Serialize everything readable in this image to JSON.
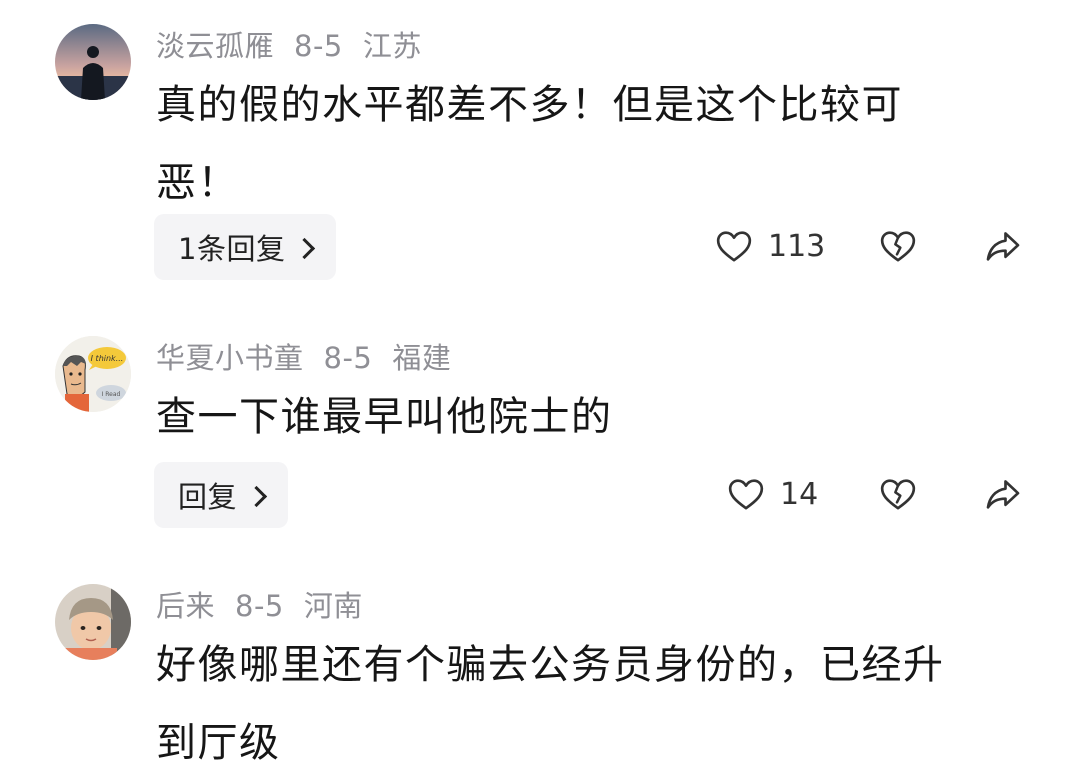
{
  "comments": [
    {
      "username": "淡云孤雁",
      "date": "8-5",
      "location": "江苏",
      "text_line1": "真的假的水平都差不多！但是这个比较可",
      "text_line2": "恶！",
      "reply_label": "1条回复",
      "like_count": "113",
      "avatar_icon": "silhouette-sunset-avatar",
      "accent_color": "#8f8f95"
    },
    {
      "username": "华夏小书童",
      "date": "8-5",
      "location": "福建",
      "text_line1": "查一下谁最早叫他院士的",
      "reply_label": "回复",
      "like_count": "14",
      "avatar_icon": "cartoon-thinking-avatar"
    },
    {
      "username": "后来",
      "date": "8-5",
      "location": "河南",
      "text_line1": "好像哪里还有个骗去公务员身份的，已经升",
      "text_line2": "到厅级",
      "avatar_icon": "child-photo-avatar"
    }
  ],
  "avatar2_bubble_text": "I think...",
  "avatar2_small_text": "I Read"
}
